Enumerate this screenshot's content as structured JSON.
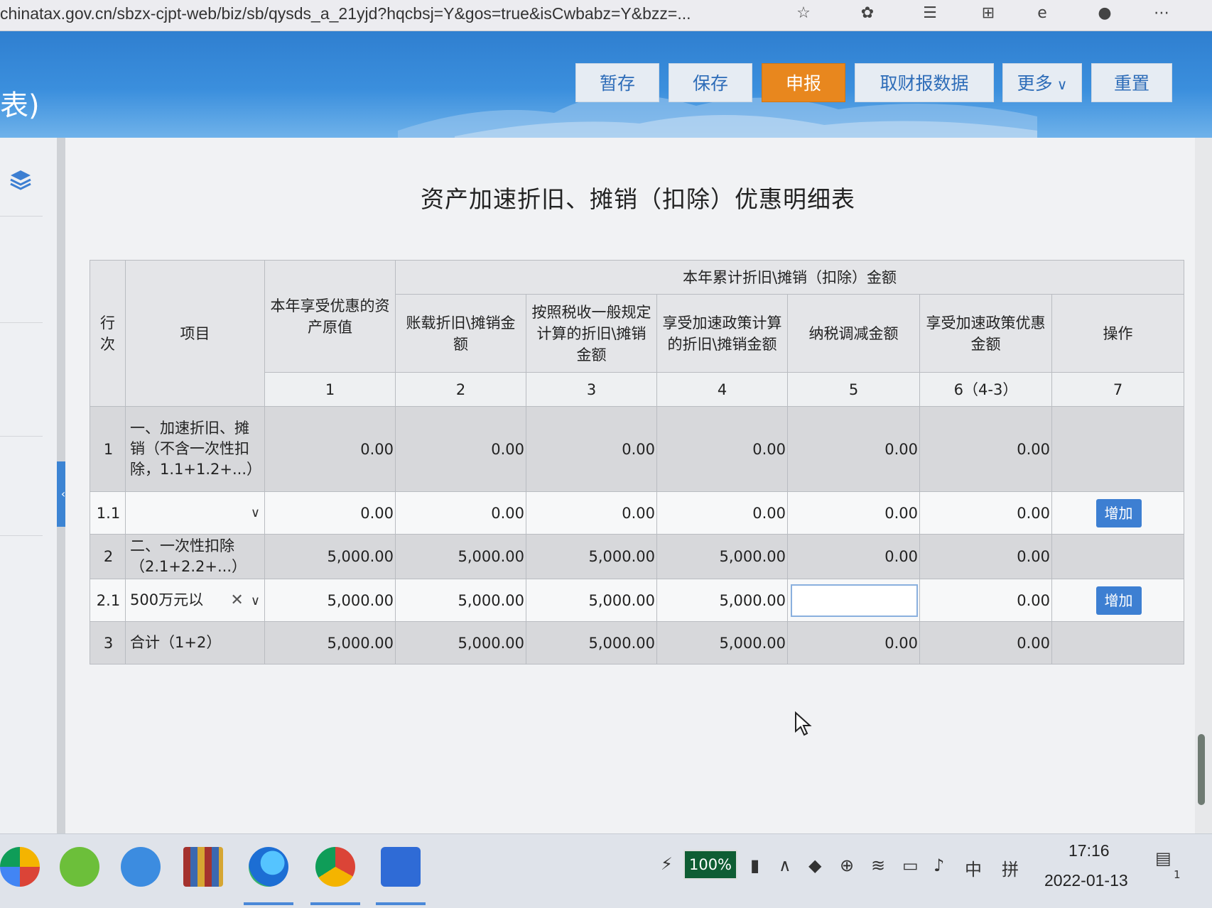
{
  "browser": {
    "url": "chinatax.gov.cn/sbzx-cjpt-web/biz/sb/qysds_a_21yjd?hqcbsj=Y&gos=true&isCwbabz=Y&bzz=..."
  },
  "header": {
    "partial_title": "表)",
    "buttons": {
      "temp_save": "暂存",
      "save": "保存",
      "declare": "申报",
      "fetch_financial": "取财报数据",
      "more": "更多",
      "reset": "重置"
    }
  },
  "page": {
    "title": "资产加速折旧、摊销（扣除）优惠明细表"
  },
  "table": {
    "headers": {
      "row_no": "行次",
      "item": "项目",
      "original_value": "本年享受优惠的资产原值",
      "group": "本年累计折旧\\摊销（扣除）金额",
      "book_depreciation": "账载折旧\\摊销金额",
      "general_depreciation": "按照税收一般规定计算的折旧\\摊销金额",
      "accelerated_depreciation": "享受加速政策计算的折旧\\摊销金额",
      "tax_reduction": "纳税调减金额",
      "preferential_amount": "享受加速政策优惠金额",
      "operation": "操作"
    },
    "col_numbers": [
      "1",
      "2",
      "3",
      "4",
      "5",
      "6（4-3）",
      "7"
    ],
    "rows": [
      {
        "no": "1",
        "item": "一、加速折旧、摊销（不含一次性扣除，1.1+1.2+...）",
        "c1": "0.00",
        "c2": "0.00",
        "c3": "0.00",
        "c4": "0.00",
        "c5": "0.00",
        "c6": "0.00"
      },
      {
        "no": "1.1",
        "item": "",
        "c1": "0.00",
        "c2": "0.00",
        "c3": "0.00",
        "c4": "0.00",
        "c5": "0.00",
        "c6": "0.00",
        "op": "增加"
      },
      {
        "no": "2",
        "item": "二、一次性扣除（2.1+2.2+...）",
        "c1": "5,000.00",
        "c2": "5,000.00",
        "c3": "5,000.00",
        "c4": "5,000.00",
        "c5": "0.00",
        "c6": "0.00"
      },
      {
        "no": "2.1",
        "item": "500万元以",
        "c1": "5,000.00",
        "c2": "5,000.00",
        "c3": "5,000.00",
        "c4": "5,000.00",
        "c5": "",
        "c6": "0.00",
        "op": "增加"
      },
      {
        "no": "3",
        "item": "合计（1+2）",
        "c1": "5,000.00",
        "c2": "5,000.00",
        "c3": "5,000.00",
        "c4": "5,000.00",
        "c5": "0.00",
        "c6": "0.00"
      }
    ]
  },
  "taskbar": {
    "battery": "100%",
    "ime_lang": "中",
    "ime_mode": "拼",
    "time": "17:16",
    "date": "2022-01-13",
    "notifications": "1"
  }
}
